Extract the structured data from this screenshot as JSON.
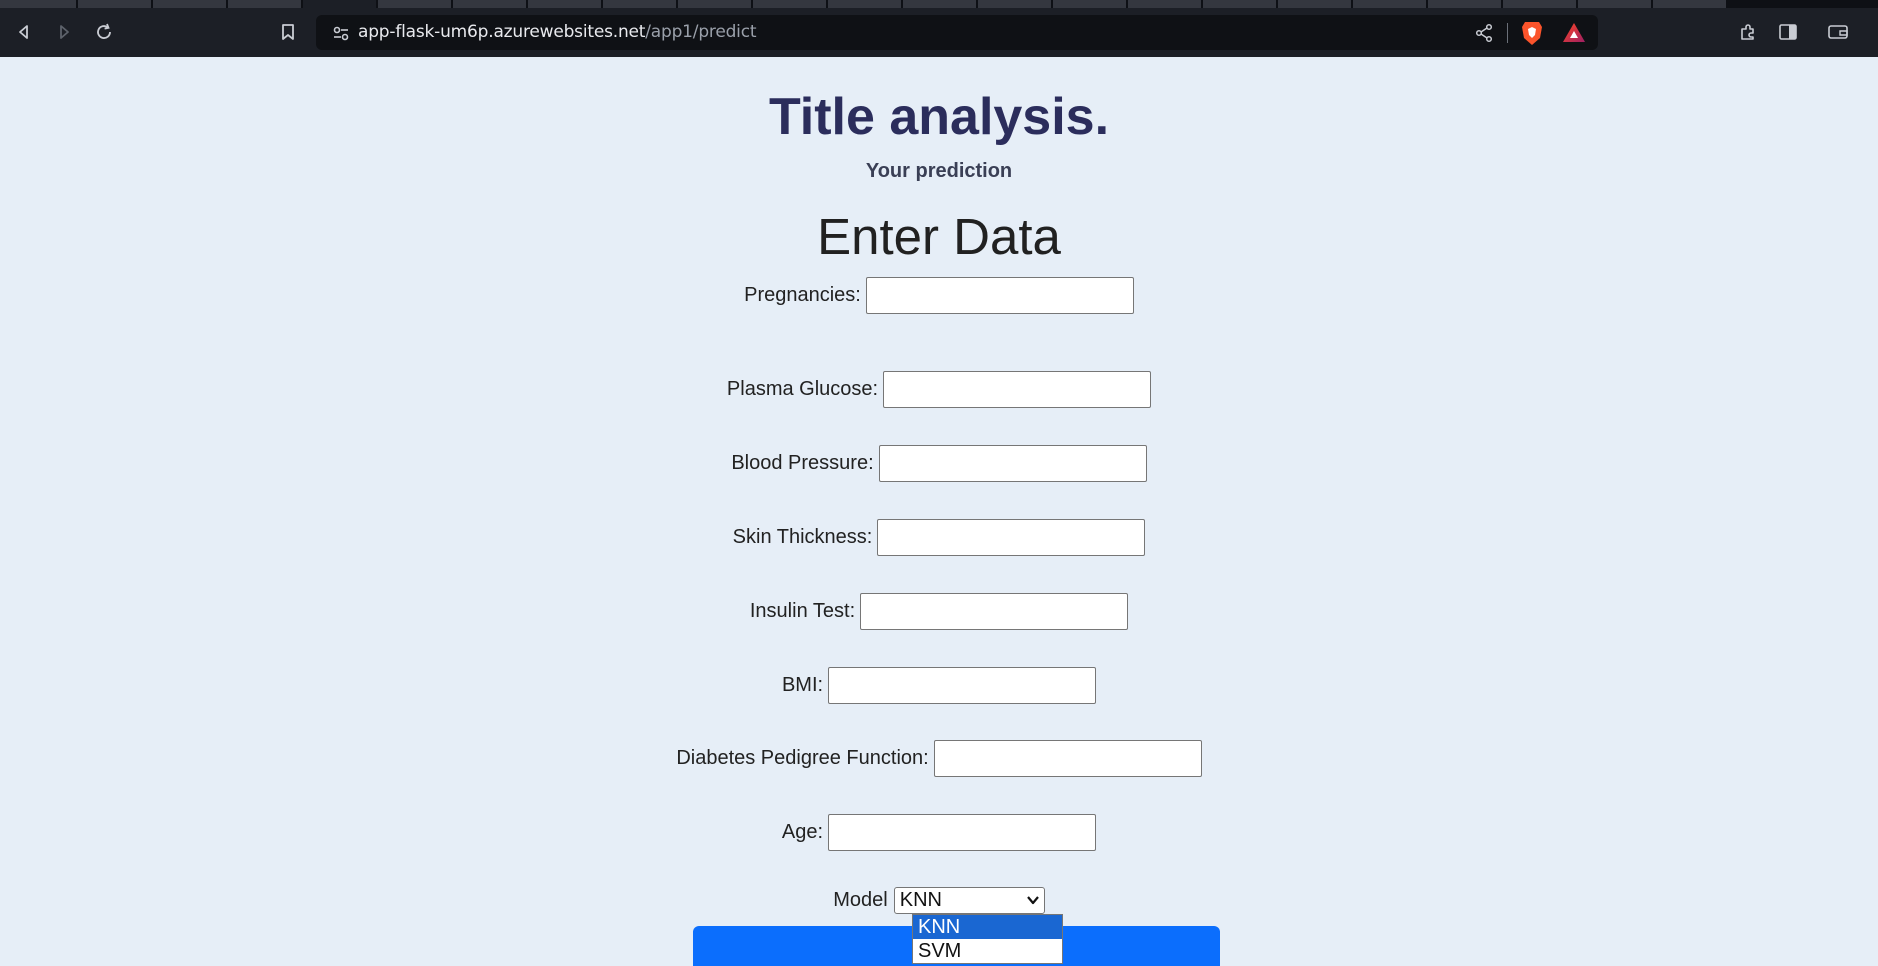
{
  "browser": {
    "url_host": "app-flask-um6p.azurewebsites.net",
    "url_path": "/app1/predict"
  },
  "page": {
    "title": "Title analysis.",
    "subtitle": "Your prediction",
    "form_heading": "Enter Data",
    "fields": [
      {
        "label": "Pregnancies:",
        "value": ""
      },
      {
        "label": "Plasma Glucose:",
        "value": ""
      },
      {
        "label": "Blood Pressure:",
        "value": ""
      },
      {
        "label": "Skin Thickness:",
        "value": ""
      },
      {
        "label": "Insulin Test:",
        "value": ""
      },
      {
        "label": "BMI:",
        "value": ""
      },
      {
        "label": "Diabetes Pedigree Function:",
        "value": ""
      },
      {
        "label": "Age:",
        "value": ""
      }
    ],
    "model_label": "Model",
    "model_selected": "KNN",
    "model_options": [
      "KNN",
      "SVM"
    ]
  },
  "colors": {
    "page_background": "#e6eef7",
    "title": "#2b2d5c",
    "button": "#0b6efd",
    "dropdown_highlight": "#1a67d2"
  }
}
